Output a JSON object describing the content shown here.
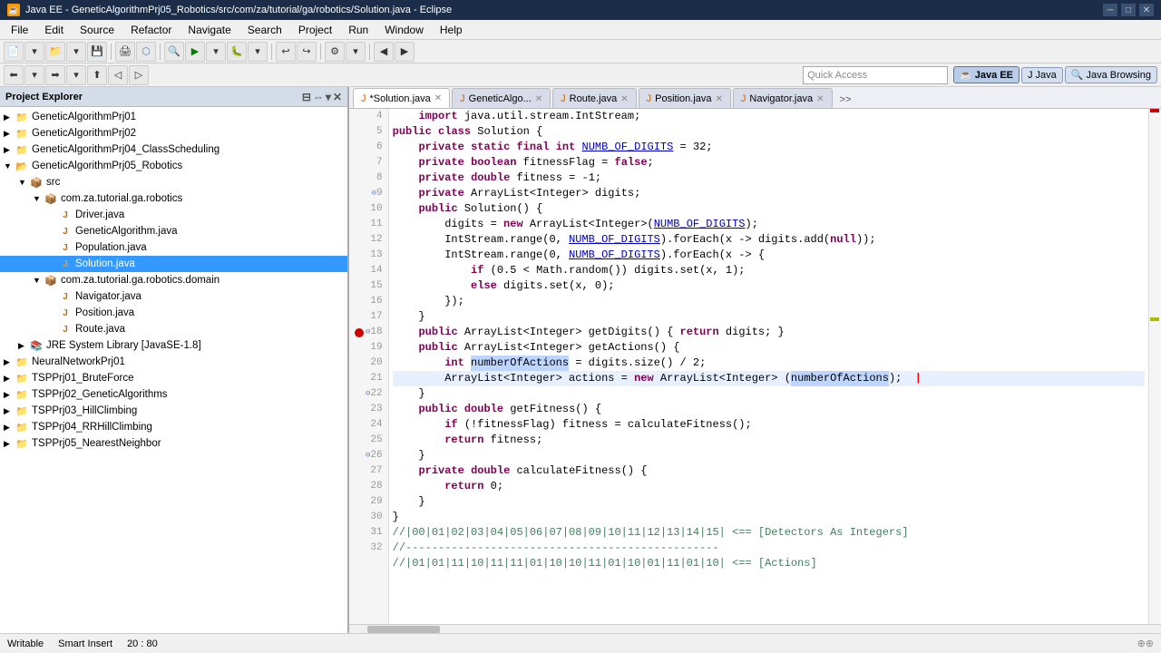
{
  "titlebar": {
    "title": "Java EE - GeneticAlgorithmPrj05_Robotics/src/com/za/tutorial/ga/robotics/Solution.java - Eclipse",
    "icon": "☕"
  },
  "menubar": {
    "items": [
      "File",
      "Edit",
      "Source",
      "Refactor",
      "Navigate",
      "Search",
      "Project",
      "Run",
      "Window",
      "Help"
    ]
  },
  "toolbar2": {
    "quick_access_placeholder": "Quick Access",
    "perspectives": [
      {
        "label": "Java EE",
        "icon": "☕",
        "active": true
      },
      {
        "label": "Java",
        "icon": "J",
        "active": false
      },
      {
        "label": "Java Browsing",
        "icon": "🔍",
        "active": false
      }
    ]
  },
  "project_explorer": {
    "title": "Project Explorer",
    "projects": [
      {
        "name": "GeneticAlgorithmPrj01",
        "level": 0,
        "type": "project"
      },
      {
        "name": "GeneticAlgorithmPrj02",
        "level": 0,
        "type": "project"
      },
      {
        "name": "GeneticAlgorithmPrj04_ClassScheduling",
        "level": 0,
        "type": "project"
      },
      {
        "name": "GeneticAlgorithmPrj05_Robotics",
        "level": 0,
        "type": "project",
        "expanded": true
      },
      {
        "name": "src",
        "level": 1,
        "type": "src",
        "expanded": true
      },
      {
        "name": "com.za.tutorial.ga.robotics",
        "level": 2,
        "type": "package",
        "expanded": true
      },
      {
        "name": "Driver.java",
        "level": 3,
        "type": "java"
      },
      {
        "name": "GeneticAlgorithm.java",
        "level": 3,
        "type": "java"
      },
      {
        "name": "Population.java",
        "level": 3,
        "type": "java"
      },
      {
        "name": "Solution.java",
        "level": 3,
        "type": "java",
        "selected": true
      },
      {
        "name": "com.za.tutorial.ga.robotics.domain",
        "level": 2,
        "type": "package",
        "expanded": true
      },
      {
        "name": "Navigator.java",
        "level": 3,
        "type": "java"
      },
      {
        "name": "Position.java",
        "level": 3,
        "type": "java"
      },
      {
        "name": "Route.java",
        "level": 3,
        "type": "java"
      },
      {
        "name": "JRE System Library [JavaSE-1.8]",
        "level": 1,
        "type": "library"
      },
      {
        "name": "NeuralNetworkPrj01",
        "level": 0,
        "type": "project"
      },
      {
        "name": "TSPPrj01_BruteForce",
        "level": 0,
        "type": "project"
      },
      {
        "name": "TSPPrj02_GeneticAlgorithms",
        "level": 0,
        "type": "project"
      },
      {
        "name": "TSPPrj03_HillClimbing",
        "level": 0,
        "type": "project"
      },
      {
        "name": "TSPPrj04_RRHillClimbing",
        "level": 0,
        "type": "project"
      },
      {
        "name": "TSPPrj05_NearestNeighbor",
        "level": 0,
        "type": "project"
      }
    ]
  },
  "editor": {
    "tabs": [
      {
        "label": "*Solution.java",
        "active": true,
        "modified": true
      },
      {
        "label": "GeneticAlgo...",
        "active": false
      },
      {
        "label": "Route.java",
        "active": false
      },
      {
        "label": "Position.java",
        "active": false
      },
      {
        "label": "Navigator.java",
        "active": false
      }
    ]
  },
  "statusbar": {
    "writable": "Writable",
    "smart_insert": "Smart Insert",
    "position": "20 : 80"
  }
}
